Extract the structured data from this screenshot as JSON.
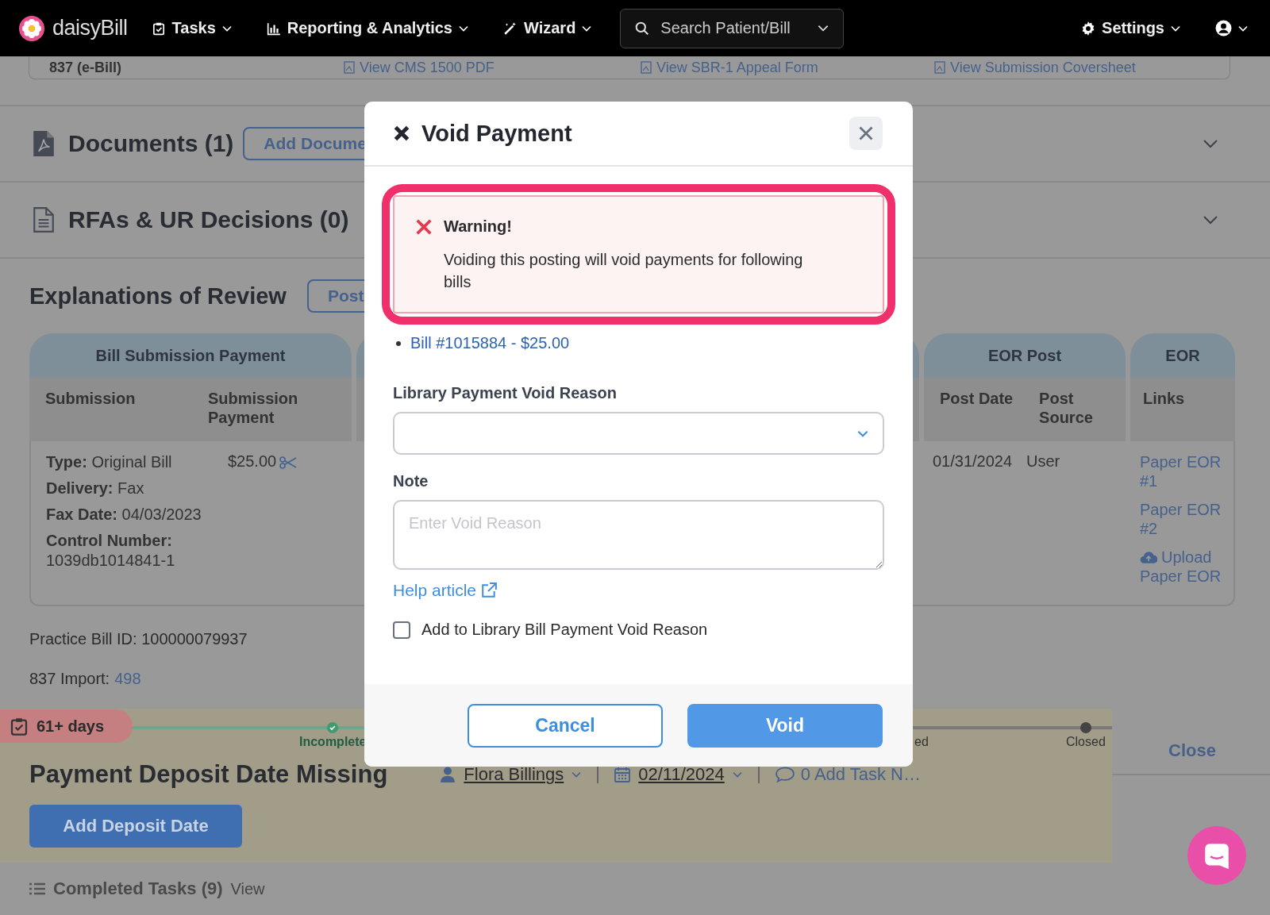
{
  "nav": {
    "brand": "daisyBill",
    "items": [
      {
        "label": "Tasks",
        "kind": "tasks"
      },
      {
        "label": "Reporting & Analytics",
        "kind": "chart"
      },
      {
        "label": "Wizard",
        "kind": "wand"
      }
    ],
    "search": {
      "placeholder": "Search Patient/Bill"
    },
    "settings": "Settings"
  },
  "bill_links": {
    "label": "837 (e-Bill)",
    "links": [
      "View CMS 1500 PDF",
      "View SBR-1 Appeal Form",
      "View Submission Coversheet"
    ]
  },
  "sections": [
    {
      "title": "Documents (1)",
      "kind": "pdf",
      "button": "Add Docume",
      "expanded": false
    },
    {
      "title": "RFAs & UR Decisions (0)",
      "kind": "document",
      "expanded": false
    }
  ],
  "eor": {
    "title": "Explanations of Review",
    "button": "Post",
    "groups": [
      {
        "title": "Bill Submission Payment",
        "columns": [
          "Submission",
          "Submission Payment"
        ]
      },
      {
        "title": "EOR Post",
        "columns": [
          "Post Date",
          "Post Source"
        ]
      },
      {
        "title": "EOR",
        "columns": [
          "Links"
        ]
      }
    ],
    "row": {
      "submission": [
        {
          "label": "Type:",
          "value": "Original Bill"
        },
        {
          "label": "Delivery:",
          "value": "Fax"
        },
        {
          "label": "Fax Date:",
          "value": "04/03/2023"
        },
        {
          "label": "Control Number:",
          "value": "1039db1014841-1"
        }
      ],
      "payment": "$25.00",
      "post_date": "01/31/2024",
      "post_source": "User",
      "links": [
        {
          "text": "Paper EOR #1",
          "kind": "link"
        },
        {
          "text": "Paper EOR #2",
          "kind": "link"
        },
        {
          "text": "Upload Paper EOR",
          "kind": "upload"
        }
      ]
    }
  },
  "practice_bill_id": {
    "label": "Practice Bill ID:",
    "value": "100000079937"
  },
  "import": {
    "label": "837 Import:",
    "value": "498"
  },
  "task": {
    "age": "61+ days",
    "stages": [
      {
        "label": "Incomplete",
        "done": true
      },
      {
        "label": "ed",
        "done": false
      },
      {
        "label": "Closed",
        "done": false
      }
    ],
    "close": "Close",
    "title": "Payment Deposit Date Missing",
    "assignee": "Flora Billings",
    "date": "02/11/2024",
    "notes": "0 Add Task N…",
    "action": "Add Deposit Date"
  },
  "completed": {
    "label": "Completed Tasks (9)",
    "link": "View"
  },
  "modal": {
    "title": "Void Payment",
    "warning": {
      "title": "Warning!",
      "message": "Voiding this posting will void payments for following bills"
    },
    "bills": [
      "Bill #1015884 - $25.00"
    ],
    "reason": {
      "label": "Library Payment Void Reason"
    },
    "note": {
      "label": "Note",
      "placeholder": "Enter Void Reason"
    },
    "help": "Help article",
    "checkbox": {
      "label": "Add to Library Bill Payment Void Reason",
      "checked": false
    },
    "buttons": [
      {
        "label": "Cancel",
        "kind": "secondary"
      },
      {
        "label": "Void",
        "kind": "primary"
      }
    ]
  }
}
